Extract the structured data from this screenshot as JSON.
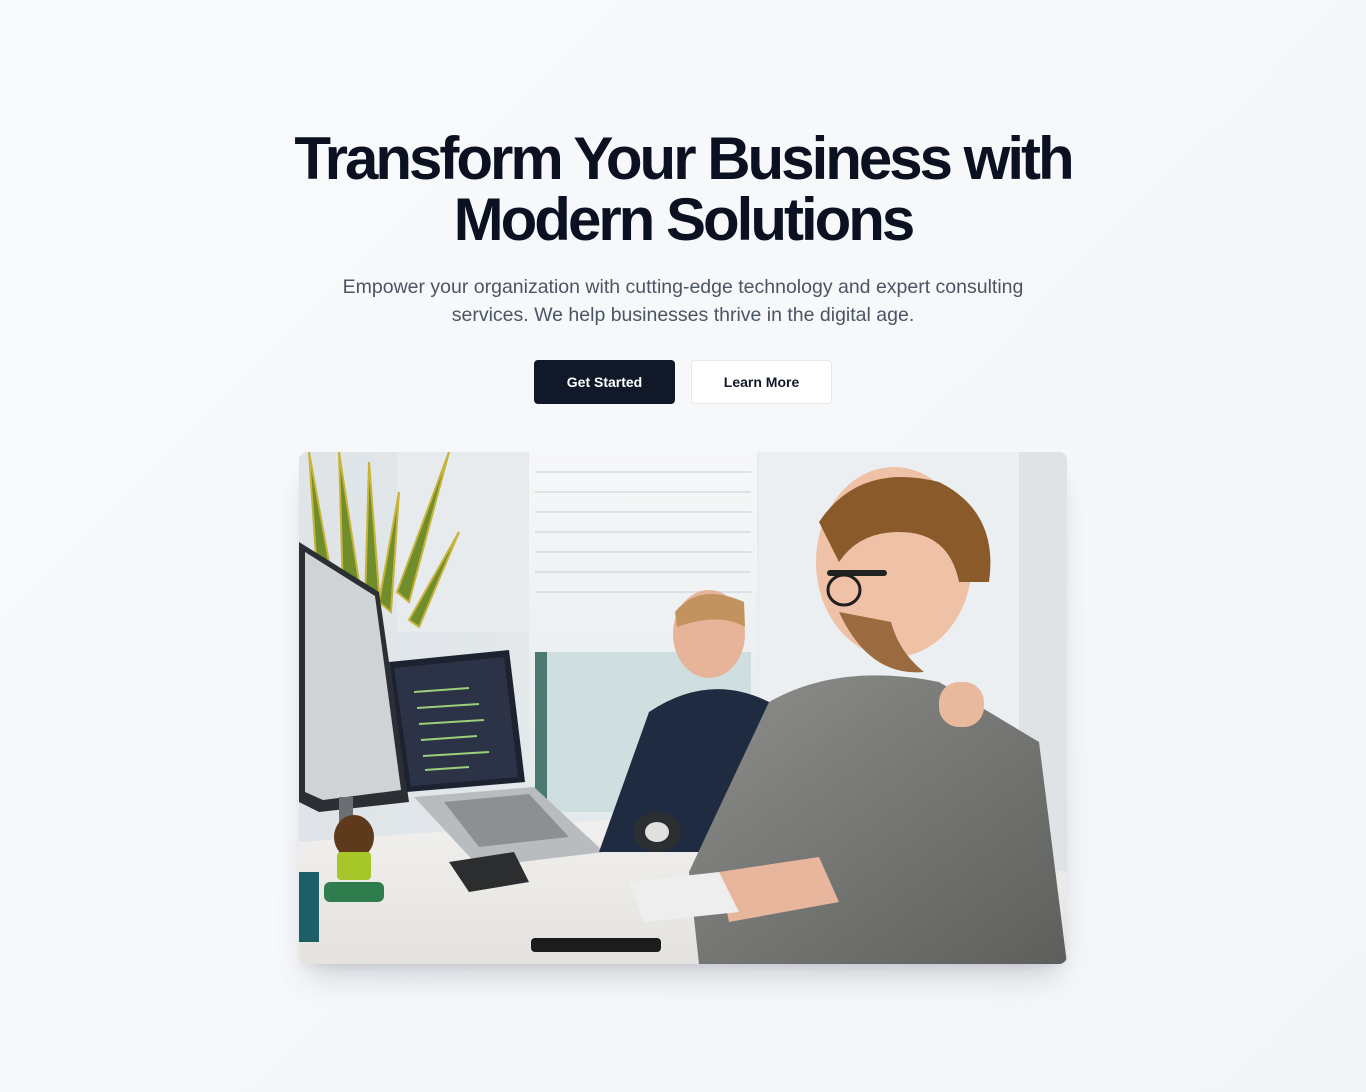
{
  "hero": {
    "headline_line1": "Transform Your Business with",
    "headline_line2": "Modern Solutions",
    "subtitle": "Empower your organization with cutting-edge technology and expert consulting services. We help businesses thrive in the digital age.",
    "primary_cta": "Get Started",
    "secondary_cta": "Learn More"
  },
  "colors": {
    "background": "#f8fafc",
    "headline": "#0b1120",
    "subtitle": "#4b5563",
    "primary_button": "#111827",
    "secondary_button": "#ffffff"
  }
}
